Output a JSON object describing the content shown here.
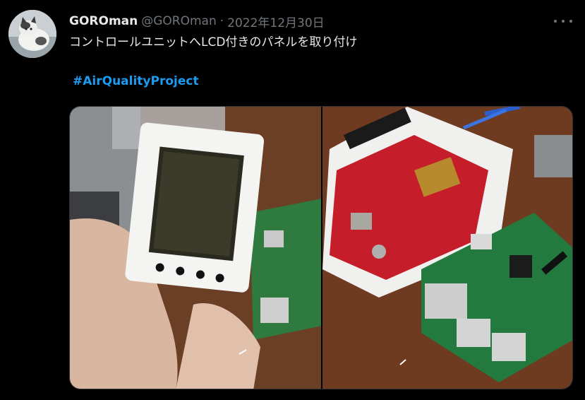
{
  "tweet": {
    "author_name": "GOROman",
    "author_handle": "@GOROman",
    "separator": "·",
    "date": "2022年12月30日",
    "text": "コントロールユニットへLCD付きのパネルを取り付け",
    "hashtag": "#AirQualityProject"
  },
  "icons": {
    "more": "more-options-icon"
  },
  "colors": {
    "background": "#000000",
    "text_primary": "#e7e9ea",
    "text_secondary": "#71767b",
    "link": "#1d9bf0"
  }
}
